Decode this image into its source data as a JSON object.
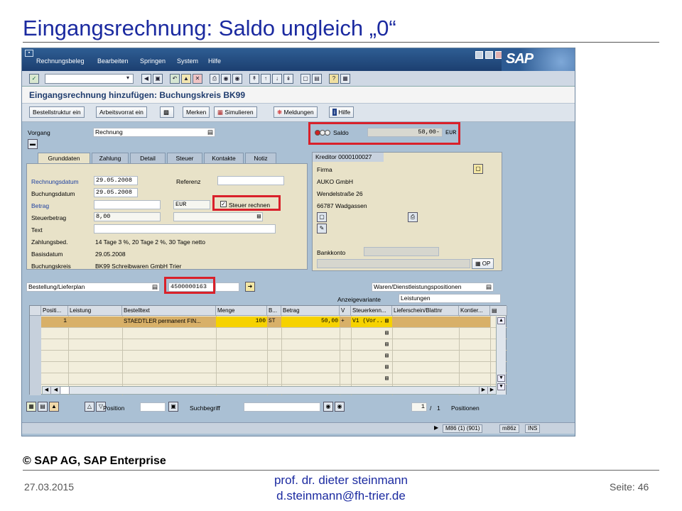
{
  "slide": {
    "title": "Eingangsrechnung: Saldo ungleich „0“",
    "copyright": "© SAP AG, SAP Enterprise",
    "date": "27.03.2015",
    "author": "prof. dr. dieter steinmann",
    "email": "d.steinmann@fh-trier.de",
    "page": "Seite: 46"
  },
  "menu": {
    "items": [
      "Rechnungsbeleg",
      "Bearbeiten",
      "Springen",
      "System",
      "Hilfe"
    ]
  },
  "logo": "SAP",
  "screen_title": "Eingangsrechnung hinzufügen: Buchungskreis BK99",
  "app_toolbar": {
    "bestellstruktur": "Bestellstruktur ein",
    "arbeitsvorrat": "Arbeitsvorrat ein",
    "merken": "Merken",
    "simulieren": "Simulieren",
    "meldungen": "Meldungen",
    "hilfe": "Hilfe"
  },
  "header": {
    "vorgang_label": "Vorgang",
    "vorgang_value": "Rechnung",
    "saldo_label": "Saldo",
    "saldo_value": "58,00-",
    "saldo_currency": "EUR"
  },
  "tabs": [
    "Grunddaten",
    "Zahlung",
    "Detail",
    "Steuer",
    "Kontakte",
    "Notiz"
  ],
  "grunddaten": {
    "rechnungsdatum_label": "Rechnungsdatum",
    "rechnungsdatum": "29.05.2008",
    "buchungsdatum_label": "Buchungsdatum",
    "buchungsdatum": "29.05.2008",
    "referenz_label": "Referenz",
    "betrag_label": "Betrag",
    "currency": "EUR",
    "steuer_rechnen": "Steuer rechnen",
    "steuerbetrag_label": "Steuerbetrag",
    "steuerbetrag": "8,00",
    "text_label": "Text",
    "zahlungsbed_label": "Zahlungsbed.",
    "zahlungsbed": "14 Tage 3 %, 20 Tage 2 %, 30 Tage netto",
    "basisdatum_label": "Basisdatum",
    "basisdatum": "29.05.2008",
    "buchungskreis_label": "Buchungskreis",
    "buchungskreis": "BK99 Schreibwaren GmbH Trier"
  },
  "kreditor": {
    "title": "Kreditor 0000100027",
    "firma": "Firma",
    "name": "AUKO GmbH",
    "street": "Wendelstraße 26",
    "city": "66787 Wadgassen",
    "bankkonto_label": "Bankkonto",
    "op": "OP"
  },
  "reference": {
    "type": "Bestellung/Lieferplan",
    "number": "4500000163",
    "positions_type": "Waren/Dienstleistungspositionen",
    "anzeige_label": "Anzeigevariante",
    "anzeige_value": "Leistungen"
  },
  "grid": {
    "columns": [
      "Positi...",
      "Leistung",
      "Bestelltext",
      "Menge",
      "B...",
      "Betrag",
      "V",
      "Steuerkenn...",
      "Lieferschein/Blattnr",
      "Kontier..."
    ],
    "row": {
      "pos": "1",
      "text": "STAEDTLER permanent FIN...",
      "menge": "100",
      "unit": "ST",
      "betrag": "50,00",
      "v": "+",
      "steuer": "V1 (Vor..."
    }
  },
  "bottom": {
    "position_label": "Position",
    "suchbegriff_label": "Suchbegriff",
    "page_current": "1",
    "page_sep": "/",
    "page_total": "1",
    "positionen_label": "Positionen"
  },
  "status": {
    "session": "M86 (1) (901)",
    "host": "m86z",
    "mode": "INS"
  }
}
